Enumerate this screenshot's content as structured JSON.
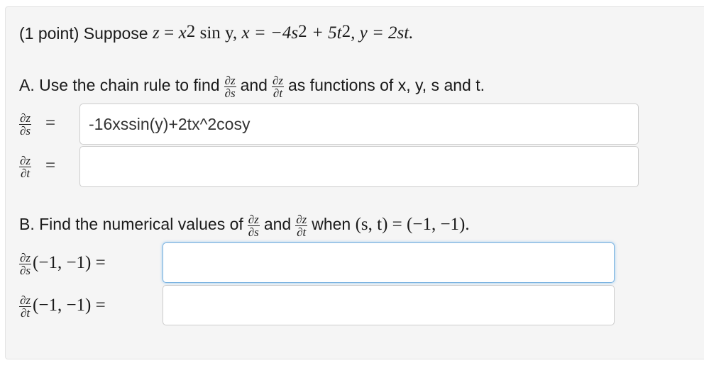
{
  "problem": {
    "points_label": "(1 point)",
    "intro_word": "Suppose",
    "formula": {
      "z": "z",
      "eq": "=",
      "x": "x",
      "exp2": "2",
      "sin_y": "sin y,",
      "x_def": "x = −4s",
      "plus_5t": "+ 5t",
      "y_def": ", y = 2st."
    }
  },
  "part_a": {
    "prefix": "A. Use the chain rule to find",
    "and_word": "and",
    "suffix": "as functions of x, y, s and t.",
    "dzds_num": "∂z",
    "dzds_den": "∂s",
    "dzdt_num": "∂z",
    "dzdt_den": "∂t",
    "equals": "=",
    "answer_dzds": "-16xssin(y)+2tx^2cosy",
    "answer_dzdt": ""
  },
  "part_b": {
    "prefix": "B. Find the numerical values of",
    "and_word": "and",
    "when_word": "when",
    "condition": "(s, t) = (−1, −1).",
    "dzds_num": "∂z",
    "dzds_den": "∂s",
    "dzdt_num": "∂z",
    "dzdt_den": "∂t",
    "point_eq": "(−1, −1) =",
    "answer_dzds_val": "",
    "answer_dzdt_val": ""
  }
}
